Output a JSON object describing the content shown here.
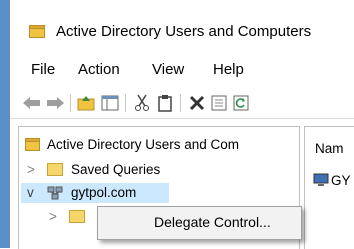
{
  "window": {
    "title": "Active Directory Users and Computers",
    "title_icon": "folder-icon"
  },
  "menu": {
    "items": [
      "File",
      "Action",
      "View",
      "Help"
    ]
  },
  "toolbar": {
    "buttons": [
      "back-arrow-icon",
      "forward-arrow-icon",
      "up-folder-icon",
      "show-console-tree-icon",
      "cut-icon",
      "copy-icon",
      "delete-icon",
      "properties-icon",
      "refresh-icon"
    ]
  },
  "tree": {
    "root_label": "Active Directory Users and Com",
    "items": [
      {
        "label": "Saved Queries",
        "expander": ">"
      },
      {
        "label": "gytpol.com",
        "expander": "v",
        "selected": true
      },
      {
        "label": "",
        "expander": ">"
      }
    ]
  },
  "list": {
    "header": "Nam",
    "first_item": "GY"
  },
  "context_menu": {
    "items": [
      "Delegate Control..."
    ]
  },
  "colors": {
    "selection": "#cce8ff",
    "accent_border": "#5b8fc7",
    "folder_yellow": "#f0c341"
  }
}
